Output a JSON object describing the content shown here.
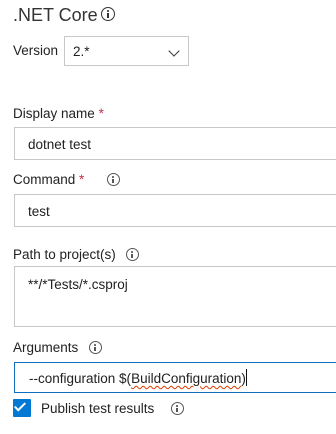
{
  "task": {
    "title": ".NET Core"
  },
  "version": {
    "label": "Version",
    "value": "2.*"
  },
  "display_name": {
    "label": "Display name",
    "required": "*",
    "value": "dotnet test"
  },
  "command": {
    "label": "Command",
    "required": "*",
    "value": "test"
  },
  "projects": {
    "label": "Path to project(s)",
    "value": "**/*Tests/*.csproj"
  },
  "arguments": {
    "label": "Arguments",
    "value_prefix": "--configuration $(",
    "value_misspelled": "BuildConfiguration",
    "value_suffix": ")"
  },
  "publish": {
    "label": "Publish test results",
    "checked": true
  },
  "icons": {
    "info": "info-circle-icon",
    "dropdown": "chevron-down-icon",
    "checkbox": "checkmark-icon"
  },
  "colors": {
    "accent": "#0078d4",
    "required": "#c4314b",
    "border": "#c8c8c8",
    "focus_border": "#106ebe",
    "spellcheck": "#d83b01"
  }
}
